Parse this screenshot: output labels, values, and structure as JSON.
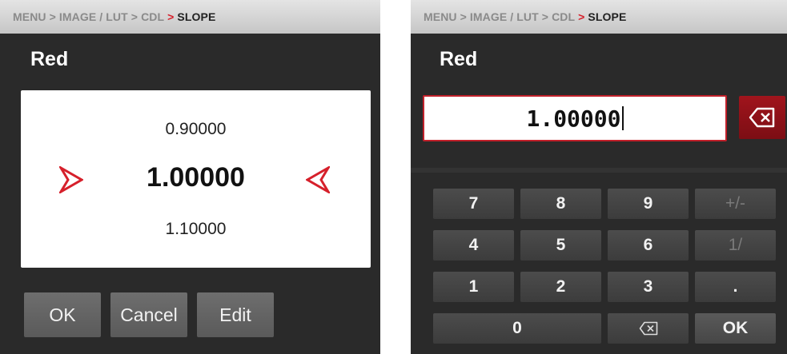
{
  "breadcrumb": {
    "items": [
      "MENU",
      "IMAGE / LUT",
      "CDL"
    ],
    "current": "SLOPE"
  },
  "parameter": {
    "name": "Red"
  },
  "picker": {
    "previous": "0.90000",
    "current": "1.00000",
    "next": "1.10000"
  },
  "buttons": {
    "ok": "OK",
    "cancel": "Cancel",
    "edit": "Edit"
  },
  "entry": {
    "value": "1.00000"
  },
  "keypad": {
    "k7": "7",
    "k8": "8",
    "k9": "9",
    "sign": "+/-",
    "k4": "4",
    "k5": "5",
    "k6": "6",
    "reciprocal": "1/",
    "k1": "1",
    "k2": "2",
    "k3": "3",
    "dot": ".",
    "k0": "0",
    "ok": "OK"
  },
  "colors": {
    "accent": "#d6202b",
    "panel": "#2a2a2a",
    "key": "#454545"
  },
  "icons": {
    "back_arrow": "chevron-right-red-icon",
    "forward_arrow": "chevron-left-red-icon",
    "backspace": "backspace-icon"
  }
}
